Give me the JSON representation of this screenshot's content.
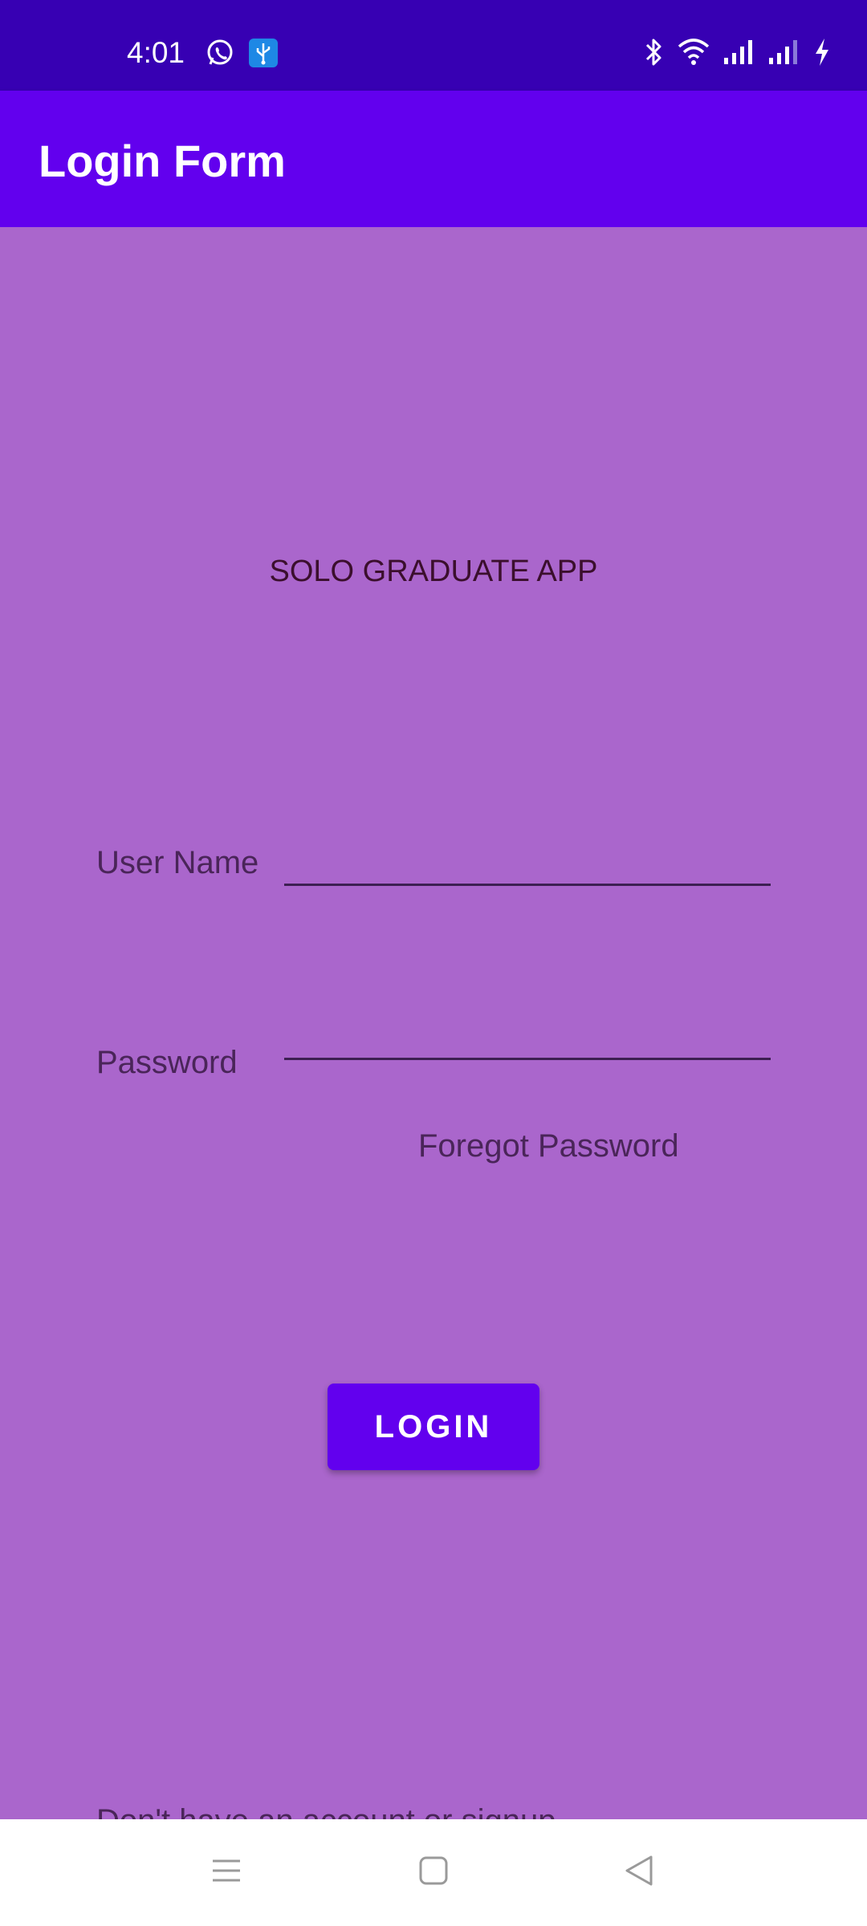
{
  "status_bar": {
    "time": "4:01",
    "left_icons": [
      "whatsapp-icon",
      "usb-icon"
    ],
    "right_icons": [
      "bluetooth-icon",
      "wifi-icon",
      "signal-icon",
      "signal-icon",
      "charging-icon"
    ]
  },
  "app_bar": {
    "title": "Login Form"
  },
  "content": {
    "app_name": "SOLO GRADUATE APP",
    "username": {
      "label": "User Name",
      "value": "",
      "placeholder": ""
    },
    "password": {
      "label": "Password",
      "value": "",
      "placeholder": ""
    },
    "forgot_label": "Foregot Password",
    "login_label": "LOGIN",
    "signup_label": "Don't have an account or signup"
  },
  "nav_bar": {
    "buttons": [
      "menu-icon",
      "home-icon",
      "back-icon"
    ]
  },
  "colors": {
    "status_bar": "#3700b3",
    "app_bar": "#6200ee",
    "background": "#aa66cc",
    "accent": "#6200ee",
    "text_muted": "#4a2559",
    "text_title": "#3b0f2d",
    "nav_bar": "#ffffff"
  }
}
